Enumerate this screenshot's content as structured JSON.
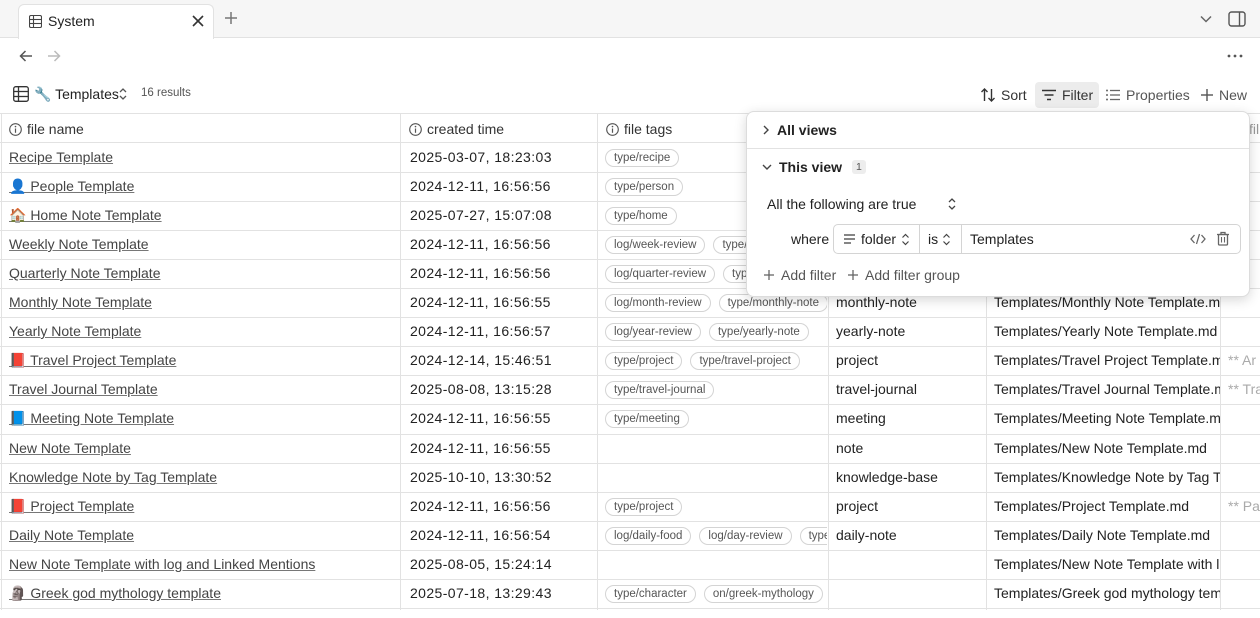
{
  "tab": {
    "title": "System"
  },
  "toolbar": {
    "view_name": "🔧 Templates",
    "results": "16 results",
    "sort_label": "Sort",
    "filter_label": "Filter",
    "properties_label": "Properties",
    "new_label": "New"
  },
  "columns": [
    "file name",
    "created time",
    "file tags"
  ],
  "rows": [
    {
      "name": "Recipe Template",
      "time": "2025-03-07, 18:23:03",
      "tags": [
        "type/recipe"
      ],
      "category": "",
      "path": "",
      "extra": ""
    },
    {
      "name": "👤 People Template",
      "time": "2024-12-11, 16:56:56",
      "tags": [
        "type/person"
      ],
      "category": "",
      "path": "",
      "extra": ""
    },
    {
      "name": "🏠 Home Note Template",
      "time": "2025-07-27, 15:07:08",
      "tags": [
        "type/home"
      ],
      "category": "",
      "path": "",
      "extra": ""
    },
    {
      "name": "Weekly Note Template",
      "time": "2024-12-11, 16:56:56",
      "tags": [
        "log/week-review",
        "type/w"
      ],
      "category": "",
      "path": "",
      "extra": ""
    },
    {
      "name": "Quarterly Note Template",
      "time": "2024-12-11, 16:56:56",
      "tags": [
        "log/quarter-review",
        "typ"
      ],
      "category": "",
      "path": "",
      "extra": ""
    },
    {
      "name": "Monthly Note Template",
      "time": "2024-12-11, 16:56:55",
      "tags": [
        "log/month-review",
        "type/monthly-note"
      ],
      "category": "monthly-note",
      "path": "Templates/Monthly Note Template.m",
      "extra": ""
    },
    {
      "name": "Yearly Note Template",
      "time": "2024-12-11, 16:56:57",
      "tags": [
        "log/year-review",
        "type/yearly-note"
      ],
      "category": "yearly-note",
      "path": "Templates/Yearly Note Template.md",
      "extra": ""
    },
    {
      "name": "📕 Travel Project Template",
      "time": "2024-12-14, 15:46:51",
      "tags": [
        "type/project",
        "type/travel-project"
      ],
      "category": "project",
      "path": "Templates/Travel Project Template.m",
      "extra": "** Ar"
    },
    {
      "name": "Travel Journal Template",
      "time": "2025-08-08, 13:15:28",
      "tags": [
        "type/travel-journal"
      ],
      "category": "travel-journal",
      "path": "Templates/Travel Journal Template.m",
      "extra": "** Tra"
    },
    {
      "name": "📘 Meeting Note Template",
      "time": "2024-12-11, 16:56:55",
      "tags": [
        "type/meeting"
      ],
      "category": "meeting",
      "path": "Templates/Meeting Note Template.m",
      "extra": ""
    },
    {
      "name": "New Note Template",
      "time": "2024-12-11, 16:56:55",
      "tags": [],
      "category": "note",
      "path": "Templates/New Note Template.md",
      "extra": ""
    },
    {
      "name": "Knowledge Note by Tag Template",
      "time": "2025-10-10, 13:30:52",
      "tags": [],
      "category": "knowledge-base",
      "path": "Templates/Knowledge Note by Tag T",
      "extra": ""
    },
    {
      "name": "📕 Project Template",
      "time": "2024-12-11, 16:56:56",
      "tags": [
        "type/project"
      ],
      "category": "project",
      "path": "Templates/Project Template.md",
      "extra": "** Pa"
    },
    {
      "name": "Daily Note Template",
      "time": "2024-12-11, 16:56:54",
      "tags": [
        "log/daily-food",
        "log/day-review",
        "type/"
      ],
      "category": "daily-note",
      "path": "Templates/Daily Note Template.md",
      "extra": ""
    },
    {
      "name": "New Note Template with log and Linked Mentions",
      "time": "2025-08-05, 15:24:14",
      "tags": [],
      "category": "",
      "path": "Templates/New Note Template with l",
      "extra": ""
    },
    {
      "name": "🗿 Greek god mythology template",
      "time": "2025-07-18, 13:29:43",
      "tags": [
        "type/character",
        "on/greek-mythology"
      ],
      "category": "",
      "path": "Templates/Greek god mythology tem",
      "extra": ""
    }
  ],
  "filter_panel": {
    "all_views": "All views",
    "this_view": "This view",
    "this_view_count": "1",
    "conjunction": "All the following are true",
    "where_label": "where",
    "property": "folder",
    "operator": "is",
    "value": "Templates",
    "add_filter": "Add filter",
    "add_filter_group": "Add filter group"
  },
  "partial_header": "fil",
  "icons": {
    "tab": "table-icon",
    "close": "close-icon",
    "add": "plus-icon",
    "back": "arrow-left-icon",
    "forward": "arrow-right-icon",
    "more": "more-horizontal-icon",
    "sort": "sort-icon",
    "filter": "filter-icon",
    "properties": "list-icon"
  }
}
